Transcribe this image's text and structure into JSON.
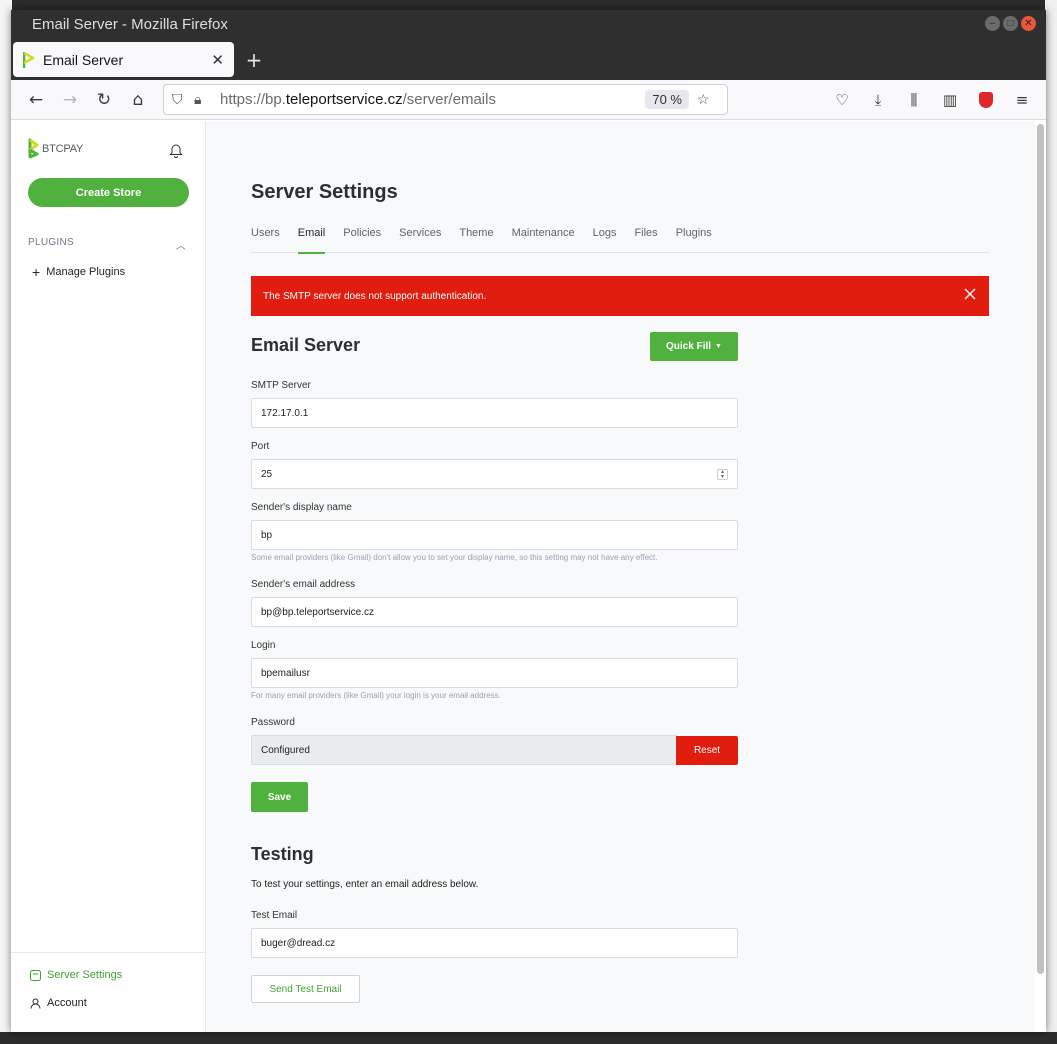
{
  "window": {
    "title": "Email Server - Mozilla Firefox"
  },
  "browser": {
    "tab_title": "Email Server",
    "url_prefix": "https://bp.",
    "url_domain": "teleportservice.cz",
    "url_path": "/server/emails",
    "zoom": "70 %"
  },
  "sidebar": {
    "brand": "BTCPAY",
    "create_store": "Create Store",
    "plugins_heading": "PLUGINS",
    "manage_plugins": "Manage Plugins",
    "server_settings": "Server Settings",
    "account": "Account"
  },
  "main": {
    "page_title": "Server Settings",
    "tabs": [
      "Users",
      "Email",
      "Policies",
      "Services",
      "Theme",
      "Maintenance",
      "Logs",
      "Files",
      "Plugins"
    ],
    "active_tab": "Email",
    "alert": "The SMTP server does not support authentication.",
    "email_server_title": "Email Server",
    "quick_fill": "Quick Fill",
    "smtp_label": "SMTP Server",
    "smtp_value": "172.17.0.1",
    "port_label": "Port",
    "port_value": "25",
    "display_name_label": "Sender's display name",
    "display_name_value": "bp",
    "display_name_hint": "Some email providers (like Gmail) don't allow you to set your display name, so this setting may not have any effect.",
    "email_label": "Sender's email address",
    "email_value": "bp@bp.teleportservice.cz",
    "login_label": "Login",
    "login_value": "bpemailusr",
    "login_hint": "For many email providers (like Gmail) your login is your email address.",
    "password_label": "Password",
    "password_value": "Configured",
    "reset": "Reset",
    "save": "Save",
    "testing_title": "Testing",
    "testing_desc": "To test your settings, enter an email address below.",
    "test_email_label": "Test Email",
    "test_email_value": "buger@dread.cz",
    "send_test": "Send Test Email"
  },
  "colors": {
    "brand_green": "#51b13e",
    "alert_red": "#e11d0f"
  }
}
